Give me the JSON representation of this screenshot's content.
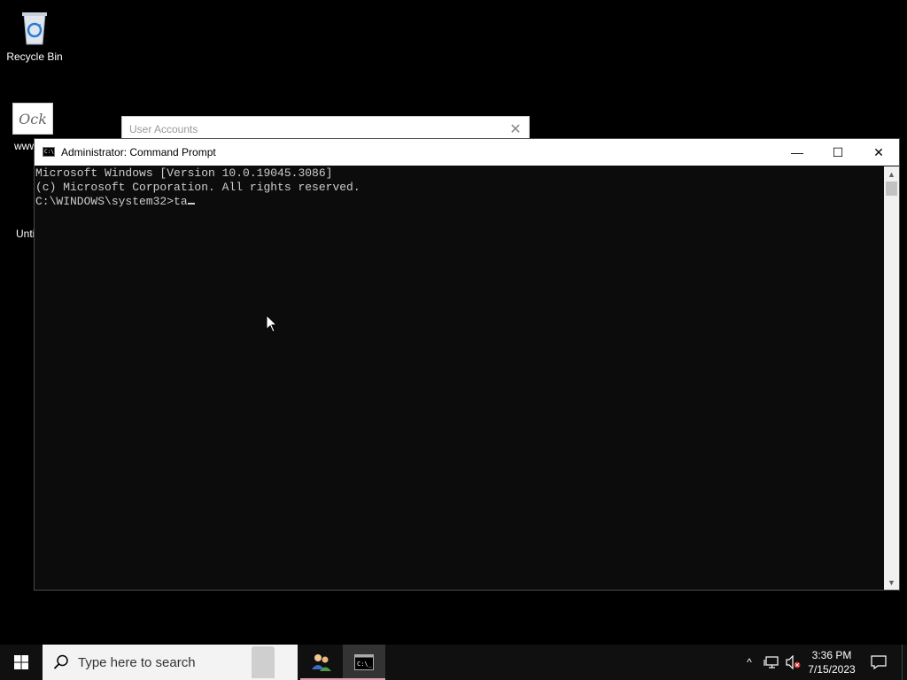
{
  "desktop": {
    "recycle_bin_label": "Recycle Bin",
    "doc_label_fragment_1": "www",
    "doc_label_fragment_2": "Unti",
    "doc_thumbnail_text": "Ock"
  },
  "user_accounts_window": {
    "title": "User Accounts",
    "close_glyph": "✕"
  },
  "cmd_window": {
    "title": "Administrator: Command Prompt",
    "minimize_glyph": "—",
    "maximize_glyph": "☐",
    "close_glyph": "✕",
    "lines": [
      "Microsoft Windows [Version 10.0.19045.3086]",
      "(c) Microsoft Corporation. All rights reserved.",
      "",
      "C:\\WINDOWS\\system32>ta"
    ],
    "scroll_up_glyph": "▲",
    "scroll_down_glyph": "▼"
  },
  "taskbar": {
    "search_placeholder": "Type here to search",
    "tray_chevron_glyph": "^",
    "clock_time": "3:36 PM",
    "clock_date": "7/15/2023",
    "icons": {
      "start": "windows-logo-icon",
      "search": "search-icon",
      "user_accounts_app": "users-icon",
      "command_prompt_app": "command-prompt-icon",
      "network": "network-icon",
      "volume": "volume-muted-icon",
      "notifications": "notification-icon"
    }
  },
  "colors": {
    "desktop_bg": "#000000",
    "console_bg": "#0c0c0c",
    "console_text": "#cccccc",
    "taskbar_bg": "#101010"
  }
}
